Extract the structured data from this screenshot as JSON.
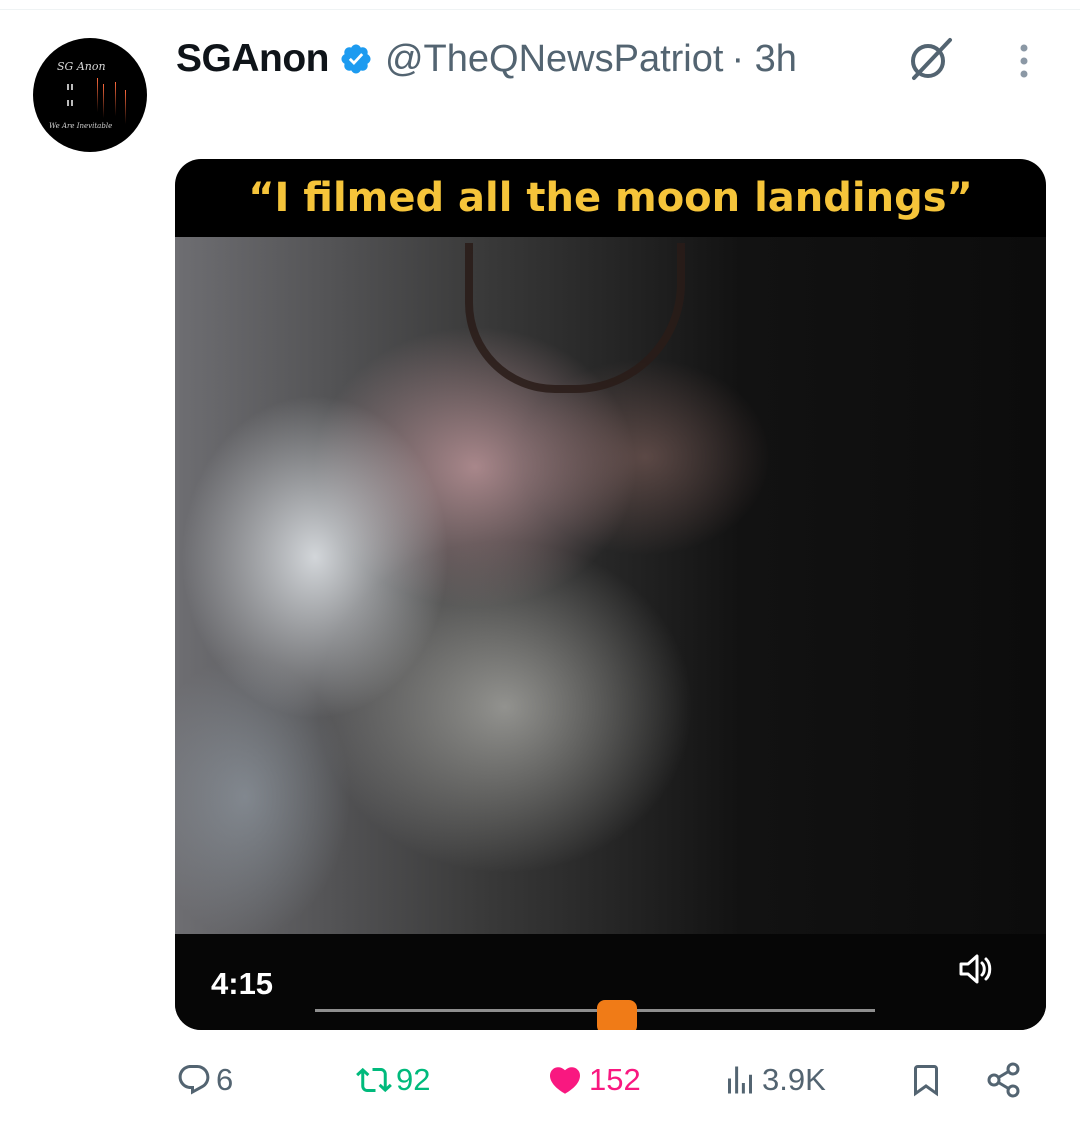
{
  "tweet": {
    "author": {
      "display_name": "SGAnon",
      "handle": "@TheQNewsPatriot",
      "timestamp": "· 3h",
      "verified": true,
      "avatar": {
        "text_top": "SG Anon",
        "text_bottom": "We Are Inevitable"
      }
    },
    "media": {
      "caption": "“I filmed all the moon landings”",
      "duration": "4:15"
    },
    "actions": {
      "replies": "6",
      "retweets": "92",
      "likes": "152",
      "views": "3.9K"
    }
  },
  "colors": {
    "verified_blue": "#1d9bf0",
    "retweet_green": "#00ba7c",
    "like_pink": "#f91880",
    "muted_gray": "#536471",
    "caption_yellow": "#f5c43a"
  },
  "icons": [
    "verified-badge-icon",
    "grok-icon",
    "more-icon",
    "volume-icon",
    "reply-icon",
    "retweet-icon",
    "like-icon",
    "views-icon",
    "bookmark-icon",
    "share-icon"
  ]
}
